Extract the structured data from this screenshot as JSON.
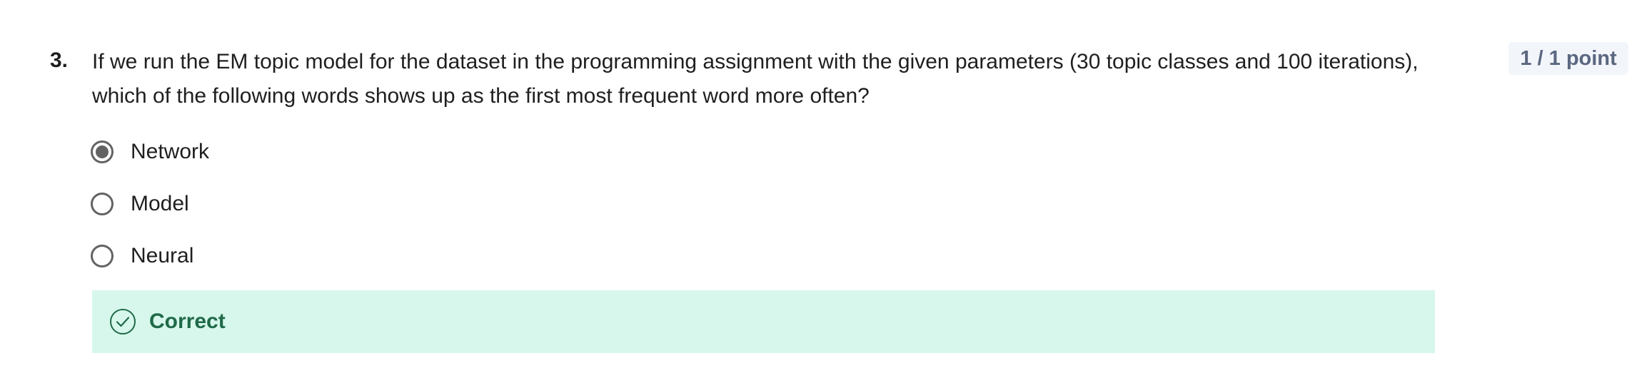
{
  "question": {
    "number": "3.",
    "text": "If we run the EM topic model for the dataset in the programming assignment with the given parameters (30 topic classes and 100 iterations), which of the following words shows up as the first most frequent word more often?",
    "points": "1 / 1 point"
  },
  "options": [
    {
      "label": "Network",
      "selected": true
    },
    {
      "label": "Model",
      "selected": false
    },
    {
      "label": "Neural",
      "selected": false
    }
  ],
  "feedback": {
    "label": "Correct",
    "icon": "check-circle-icon"
  },
  "colors": {
    "feedback_bg": "#d7f7ec",
    "feedback_text": "#1f6a48",
    "badge_bg": "#f2f5fa",
    "badge_text": "#5b6780",
    "radio": "#636363"
  }
}
